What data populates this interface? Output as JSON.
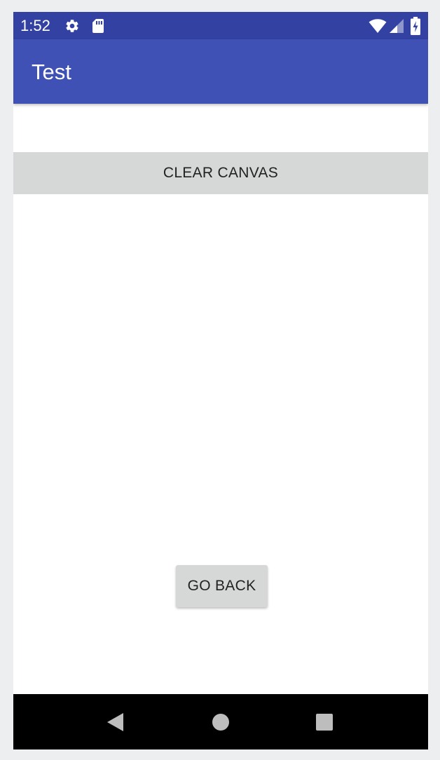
{
  "status_bar": {
    "time": "1:52",
    "icons": [
      "settings-icon",
      "sd-card-icon",
      "wifi-icon",
      "cell-signal-icon",
      "battery-charging-icon"
    ],
    "background": "#3241a2"
  },
  "app_bar": {
    "title": "Test",
    "background": "#3f51b5"
  },
  "main": {
    "clear_button_label": "CLEAR CANVAS",
    "go_back_button_label": "GO BACK",
    "button_background": "#d6d7d7"
  },
  "nav_bar": {
    "buttons": [
      "back-icon",
      "home-icon",
      "recents-icon"
    ],
    "background": "#000000"
  }
}
